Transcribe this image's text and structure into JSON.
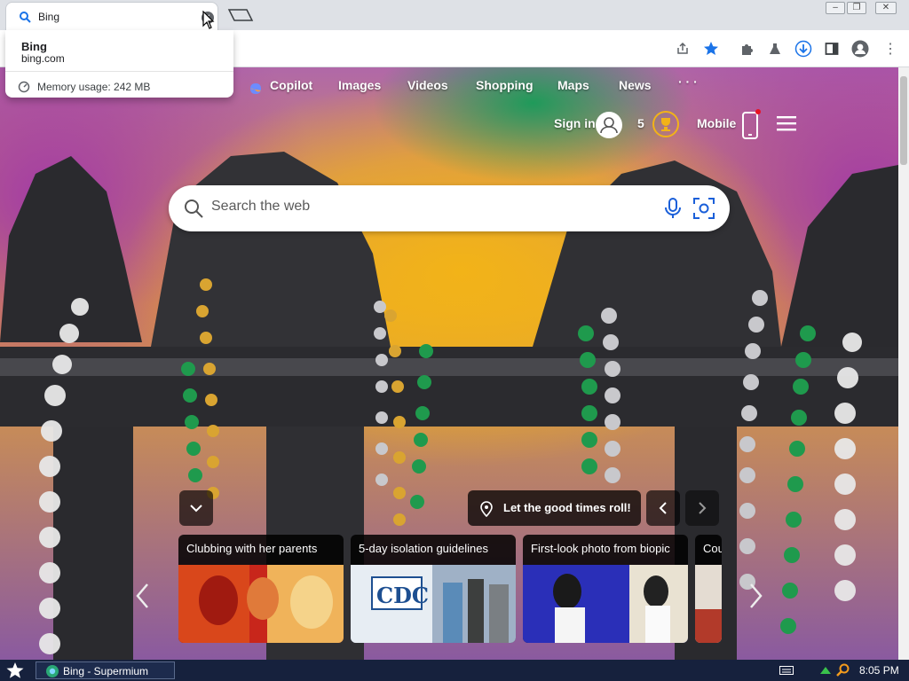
{
  "tab": {
    "title": "Bing",
    "close_symbol": "×"
  },
  "omnibox": {
    "suggestion_title": "Bing",
    "suggestion_url": "bing.com",
    "memory_label": "Memory usage: 242 MB"
  },
  "bing_nav": [
    "Copilot",
    "Images",
    "Videos",
    "Shopping",
    "Maps",
    "News",
    "· · ·"
  ],
  "header": {
    "sign_in": "Sign in",
    "rewards_count": "5",
    "mobile": "Mobile"
  },
  "search": {
    "placeholder": "Search the web"
  },
  "caption": {
    "text": "Let the good times roll!"
  },
  "cards": [
    {
      "title": "Clubbing with her parents"
    },
    {
      "title": "5-day isolation guidelines"
    },
    {
      "title": "First-look photo from biopic"
    },
    {
      "title": "Cou"
    }
  ],
  "cdc_logo_text": "CDC",
  "taskbar": {
    "app_label": "Bing - Supermium",
    "time": "8:05 PM"
  },
  "colors": {
    "accent": "#1a73e8",
    "taskbar": "#16213d",
    "sbox": "#ffffff"
  }
}
